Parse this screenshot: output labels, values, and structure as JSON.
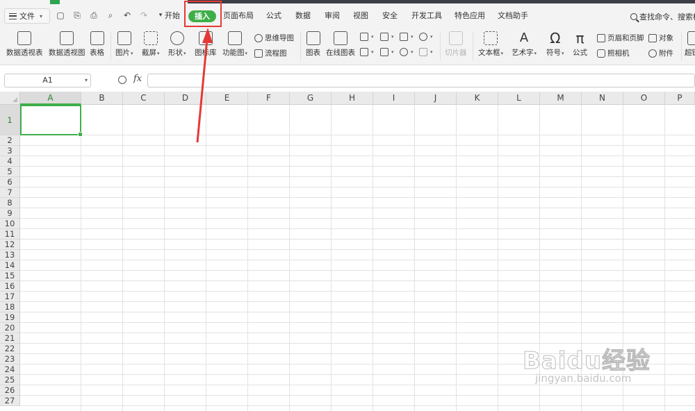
{
  "menubar": {
    "file_label": "文件",
    "tabs": [
      "开始",
      "插入",
      "页面布局",
      "公式",
      "数据",
      "审阅",
      "视图",
      "安全",
      "开发工具",
      "特色应用",
      "文档助手"
    ],
    "active_tab": "插入",
    "search_label": "查找命令、搜索模"
  },
  "ribbon": {
    "pivot_table": "数据透视表",
    "pivot_chart": "数据透视图",
    "table": "表格",
    "picture": "图片",
    "screenshot": "截屏",
    "shape": "形状",
    "icon_lib": "图标库",
    "function_chart": "功能图",
    "mind_map": "思维导图",
    "flowchart": "流程图",
    "chart": "图表",
    "online_chart": "在线图表",
    "slicer": "切片器",
    "textbox": "文本框",
    "wordart": "艺术字",
    "symbol": "符号",
    "formula": "公式",
    "header_footer": "页眉和页脚",
    "object": "对象",
    "camera": "照相机",
    "attachment": "附件",
    "hyperlink": "超链"
  },
  "formula_bar": {
    "name_box": "A1",
    "fx_label": "fx",
    "formula_value": ""
  },
  "grid": {
    "columns": [
      "A",
      "B",
      "C",
      "D",
      "E",
      "F",
      "G",
      "H",
      "I",
      "J",
      "K",
      "L",
      "M",
      "N",
      "O",
      "P"
    ],
    "rows": [
      "1",
      "2",
      "3",
      "4",
      "5",
      "6",
      "7",
      "8",
      "9",
      "10",
      "11",
      "12",
      "13",
      "14",
      "15",
      "16",
      "17",
      "18",
      "19",
      "20",
      "21",
      "22",
      "23",
      "24",
      "25",
      "26",
      "27"
    ],
    "selected_cell": "A1"
  },
  "watermark": {
    "brand": "Baidu经验",
    "url": "jingyan.baidu.com"
  },
  "colors": {
    "accent_green": "#3fae49",
    "annotation_red": "#e53935"
  }
}
